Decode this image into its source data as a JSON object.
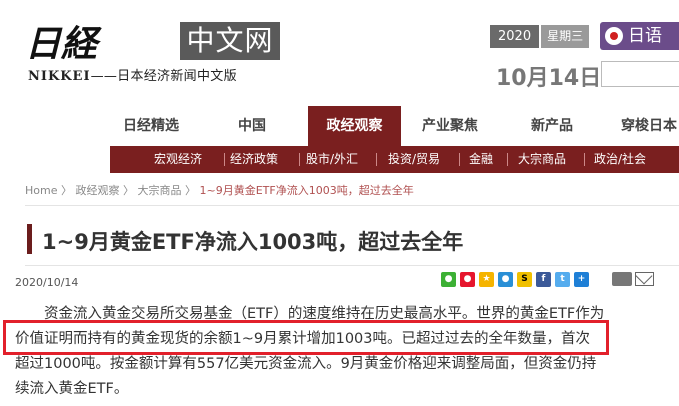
{
  "header": {
    "logo_text": "日経",
    "logo_box": "中文网",
    "subtitle_en": "NIKKEI",
    "subtitle_cn": "——日本经济新闻中文版",
    "year": "2020",
    "weekday": "星期三",
    "date_month": "10月",
    "date_day": "14日",
    "jp_link": "日语"
  },
  "nav": {
    "items": [
      "日经精选",
      "中国",
      "政经观察",
      "产业聚焦",
      "新产品",
      "穿梭日本"
    ],
    "active": "政经观察"
  },
  "subnav": {
    "items": [
      "宏观经济",
      "经济政策",
      "股市/外汇",
      "投资/贸易",
      "金融",
      "大宗商品",
      "政治/社会"
    ]
  },
  "breadcrumb": {
    "items": [
      "Home",
      "政经观察",
      "大宗商品"
    ],
    "current": "1~9月黄金ETF净流入1003吨，超过去全年",
    "sep": "〉"
  },
  "article": {
    "title": "1~9月黄金ETF净流入1003吨，超过去全年",
    "date": "2020/10/14",
    "lines": [
      "　　资金流入黄金交易所交易基金（ETF）的速度维持在历史最高水平。世界的黄金ETF作为",
      "价值证明而持有的黄金现货的余额1~9月累计增加1003吨。已超过过去的全年数量，首次",
      "超过1000吨。按金额计算有557亿美元资金流入。9月黄金价格迎来调整局面，但资金仍持",
      "续流入黄金ETF。"
    ]
  },
  "share_icons": [
    "wechat-icon",
    "weibo-icon",
    "qzone-icon",
    "pengyou-icon",
    "sohu-icon",
    "facebook-icon",
    "twitter-icon",
    "plus-icon"
  ],
  "colors": {
    "brand": "#7a1f1f",
    "highlight": "#e2202b",
    "purple": "#6b4c8a"
  }
}
